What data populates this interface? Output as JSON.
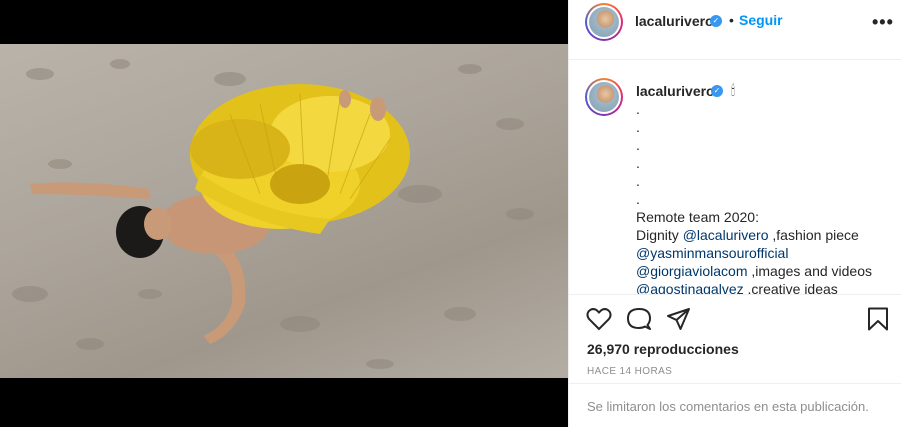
{
  "post": {
    "username": "lacalurivero",
    "follow_label": "Seguir",
    "dot": "•",
    "verified_mark": "✓",
    "more_label": "•••"
  },
  "caption": {
    "username": "lacalurivero",
    "emoji": "🕯",
    "dots": [
      ".",
      ".",
      ".",
      ".",
      ".",
      "."
    ],
    "line_title": "Remote team 2020:",
    "line1_prefix": "Dignity ",
    "line1_mention": "@lacalurivero",
    "line1_suffix": " ,fashion piece",
    "line2_mention": "@yasminmansourofficial",
    "line3_mention": "@giorgiaviolacom",
    "line3_suffix": " ,images and videos",
    "line4_mention": "@agostinagalvez",
    "line4_suffix": " ,creative ideas"
  },
  "actions": {
    "like_icon": "heart-icon",
    "comment_icon": "comment-icon",
    "share_icon": "share-icon",
    "save_icon": "bookmark-icon",
    "views": "26,970 reproducciones",
    "time_ago": "HACE 14 HORAS",
    "comments_limited": "Se limitaron los comentarios en esta publicación."
  },
  "media": {
    "mute_icon": "speaker-icon"
  },
  "colors": {
    "accent": "#0095f6",
    "verified": "#3897f0",
    "mention": "#00376b",
    "muted_text": "#8e8e8e"
  }
}
